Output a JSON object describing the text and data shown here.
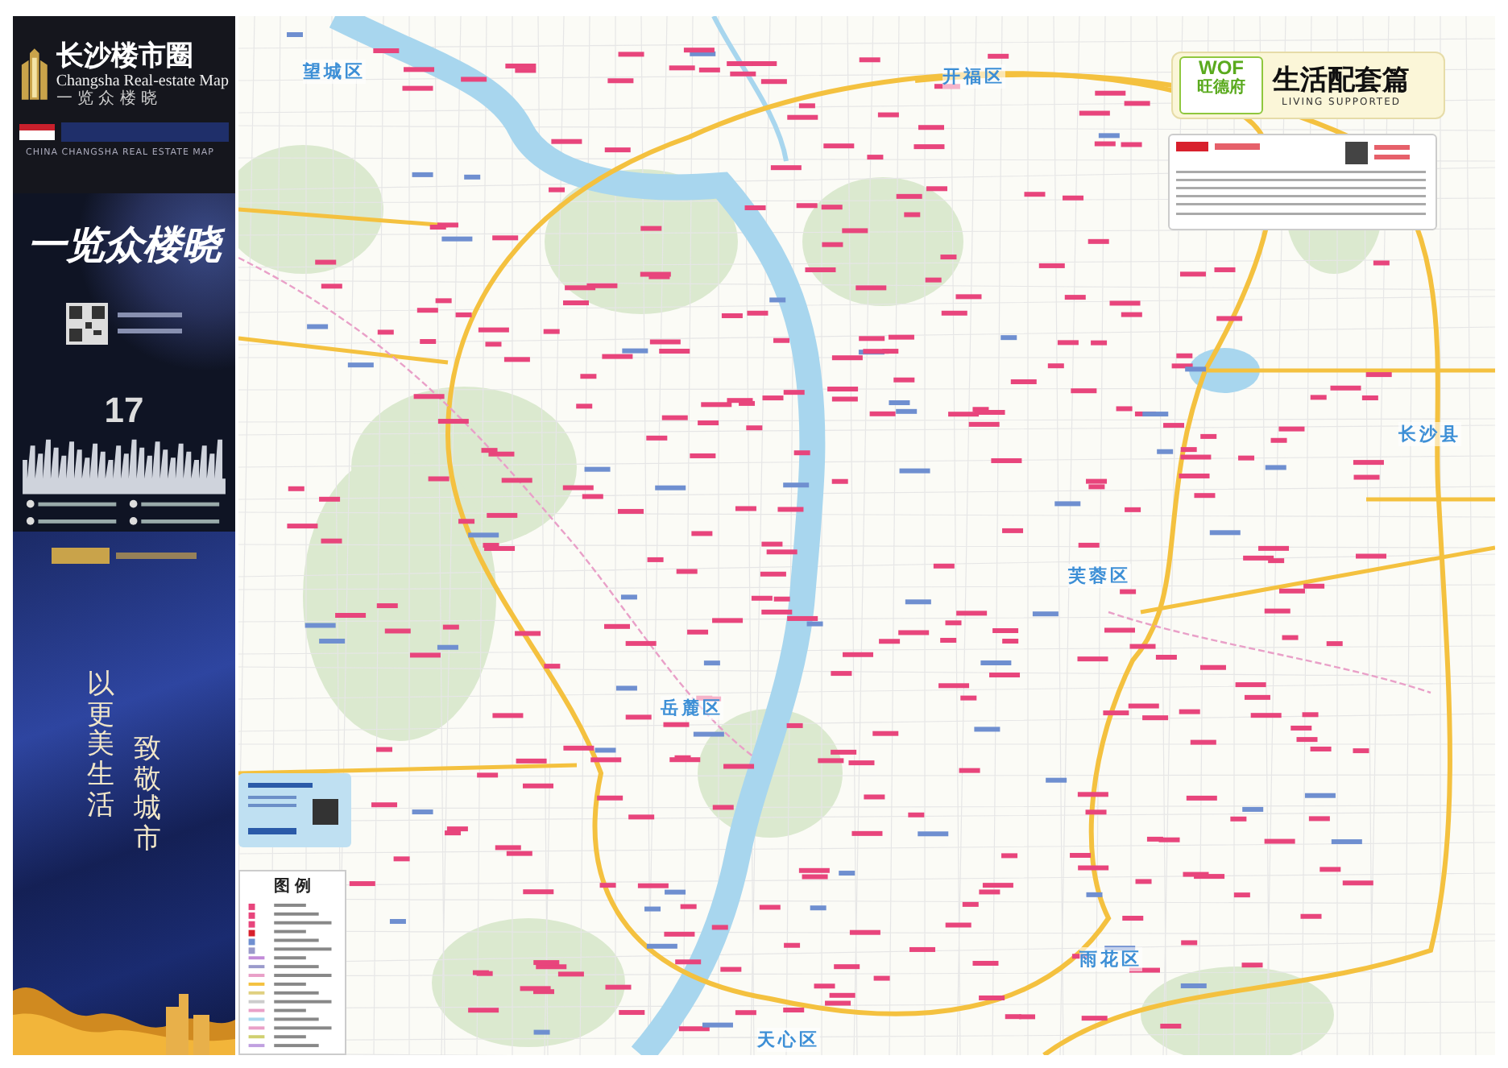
{
  "sidebar": {
    "top_ad": {
      "title": "长沙楼市圈",
      "subtitle": "Changsha Real-estate Map",
      "tagline": "一 览 众 楼 晓",
      "caption": "CHINA CHANGSHA REAL ESTATE MAP"
    },
    "middle_ad": {
      "slogan": "一览众楼晓",
      "number": "17"
    },
    "bottom_ad": {
      "line_1": "以更美生活",
      "line_2": "致敬城市"
    }
  },
  "map": {
    "title_panel": {
      "logo": "WOF",
      "brand": "旺德府",
      "title": "生活配套篇",
      "subtitle": "LIVING SUPPORTED"
    },
    "legend": {
      "title": "图 例"
    },
    "districts": [
      {
        "name": "望城区"
      },
      {
        "name": "开福区"
      },
      {
        "name": "长沙县"
      },
      {
        "name": "芙蓉区"
      },
      {
        "name": "岳麓区"
      },
      {
        "name": "雨花区"
      },
      {
        "name": "天心区"
      }
    ]
  }
}
